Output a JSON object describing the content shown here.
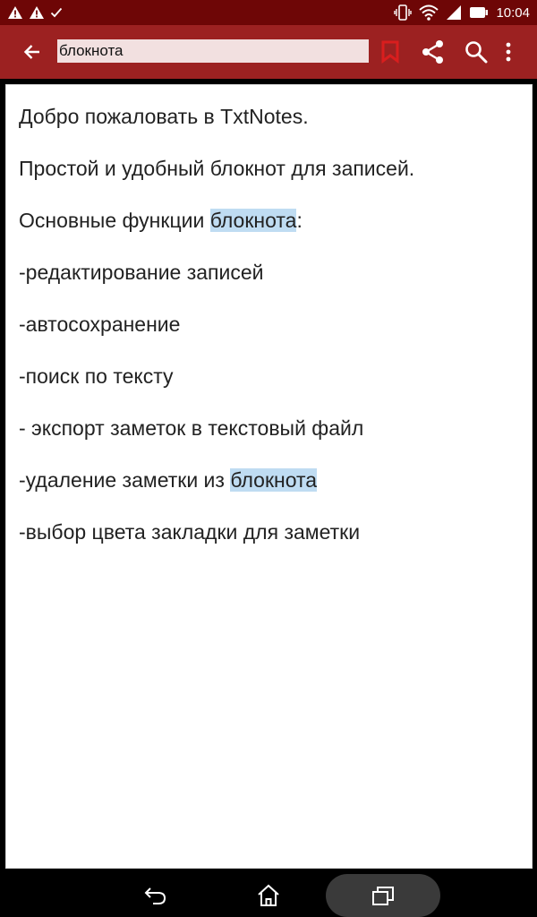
{
  "status_bar": {
    "time": "10:04",
    "left_icons": [
      "warning-icon",
      "warning-icon",
      "check-icon"
    ],
    "right_icons": [
      "vibrate-icon",
      "wifi-icon",
      "signal-icon",
      "battery-icon"
    ]
  },
  "toolbar": {
    "search_query": "блокнота",
    "bookmark_color": "#d91e1e",
    "background_color": "#9c2121"
  },
  "note": {
    "highlight_term": "блокнота",
    "highlight_color": "#bfdcf2",
    "lines": [
      {
        "text": "Добро пожаловать в TxtNotes."
      },
      {
        "text": "Простой и удобный блокнот для записей."
      },
      {
        "before": "Основные функции ",
        "highlight": "блокнота",
        "after": ":"
      },
      {
        "text": "-редактирование записей"
      },
      {
        "text": "-автосохранение"
      },
      {
        "text": "-поиск по тексту"
      },
      {
        "text": "- экспорт заметок в текстовый файл"
      },
      {
        "before": "-удаление заметки из ",
        "highlight": "блокнота",
        "after": ""
      },
      {
        "text": "-выбор цвета закладки для заметки"
      }
    ]
  },
  "nav_bar": {
    "icons": [
      "back-icon",
      "home-icon",
      "recents-icon"
    ]
  }
}
